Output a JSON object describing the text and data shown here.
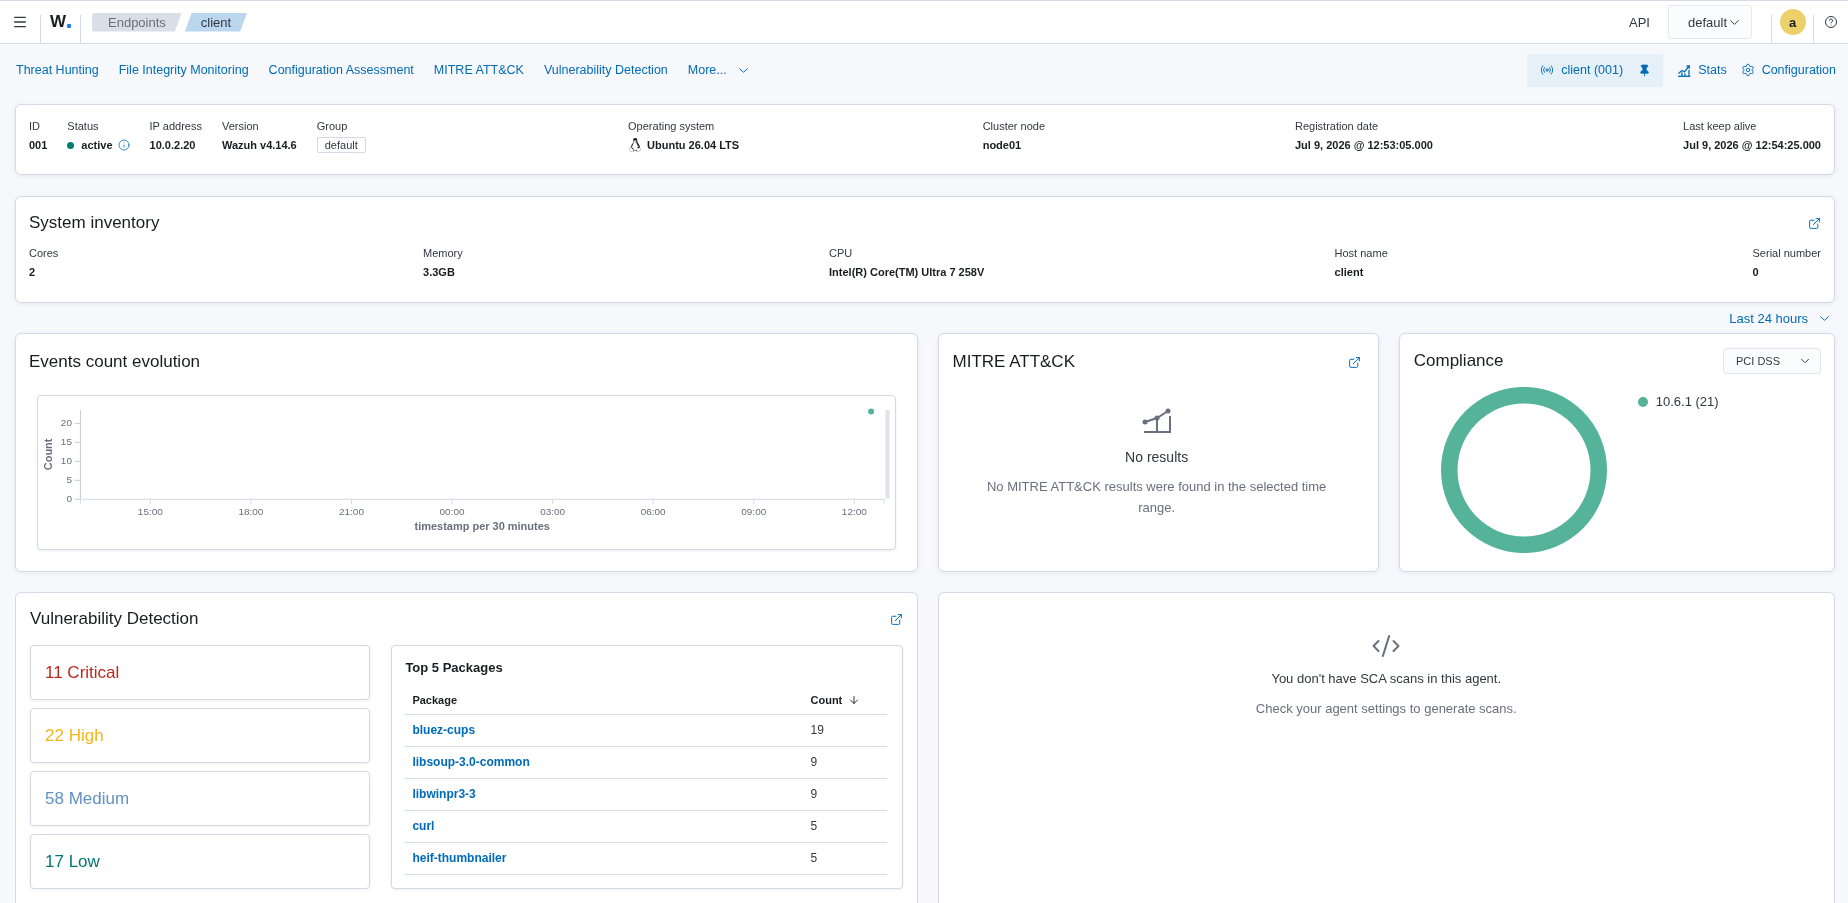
{
  "header": {
    "logo": "W",
    "breadcrumbs": [
      {
        "label": "Endpoints",
        "selected": false
      },
      {
        "label": "client",
        "selected": true
      }
    ],
    "api_label": "API",
    "api_select": "default",
    "avatar": "a"
  },
  "nav": {
    "links": [
      "Threat Hunting",
      "File Integrity Monitoring",
      "Configuration Assessment",
      "MITRE ATT&CK",
      "Vulnerability Detection"
    ],
    "more": "More...",
    "agent": "client (001)",
    "actions": [
      {
        "label": "Stats",
        "kind": "stats"
      },
      {
        "label": "Configuration",
        "kind": "settings"
      }
    ]
  },
  "agent_info": {
    "fields": [
      {
        "label": "ID",
        "value": "001",
        "kind": "text"
      },
      {
        "label": "Status",
        "value": "active",
        "kind": "status",
        "color": "#017d73"
      },
      {
        "label": "IP address",
        "value": "10.0.2.20",
        "kind": "text"
      },
      {
        "label": "Version",
        "value": "Wazuh v4.14.6",
        "kind": "text"
      },
      {
        "label": "Group",
        "value": "default",
        "kind": "badge"
      },
      {
        "label": "Operating system",
        "value": "Ubuntu 26.04 LTS",
        "kind": "os"
      },
      {
        "label": "Cluster node",
        "value": "node01",
        "kind": "text"
      },
      {
        "label": "Registration date",
        "value": "Jul 9, 2026 @ 12:53:05.000",
        "kind": "text"
      },
      {
        "label": "Last keep alive",
        "value": "Jul 9, 2026 @ 12:54:25.000",
        "kind": "text"
      }
    ]
  },
  "system_inventory": {
    "title": "System inventory",
    "fields": [
      {
        "label": "Cores",
        "value": "2"
      },
      {
        "label": "Memory",
        "value": "3.3GB"
      },
      {
        "label": "CPU",
        "value": "Intel(R) Core(TM) Ultra 7 258V"
      },
      {
        "label": "Host name",
        "value": "client"
      },
      {
        "label": "Serial number",
        "value": "0"
      }
    ]
  },
  "time_range": "Last 24 hours",
  "events": {
    "title": "Events count evolution",
    "chart_data": {
      "type": "line",
      "xlabel": "timestamp per 30 minutes",
      "ylabel": "Count",
      "x": [
        "2026-07-09T12:30"
      ],
      "series": [
        {
          "color": "#54b399",
          "values": [
            23
          ],
          "marker": "circle"
        }
      ],
      "xlim": [
        "2026-07-08T12:54",
        "2026-07-09T12:54"
      ],
      "ylim": [
        0,
        23.4
      ],
      "xticks": [
        {
          "value": "2026-07-08T15:00",
          "label": "15:00"
        },
        {
          "value": "2026-07-08T18:00",
          "label": "18:00"
        },
        {
          "value": "2026-07-08T21:00",
          "label": "21:00"
        },
        {
          "value": "2026-07-09T00:00",
          "label": "00:00"
        },
        {
          "value": "2026-07-09T03:00",
          "label": "03:00"
        },
        {
          "value": "2026-07-09T06:00",
          "label": "06:00"
        },
        {
          "value": "2026-07-09T09:00",
          "label": "09:00"
        },
        {
          "value": "2026-07-09T12:00",
          "label": "12:00"
        }
      ],
      "yticks": [
        0,
        5,
        10,
        15,
        20
      ]
    }
  },
  "mitre": {
    "title": "MITRE ATT&CK",
    "empty_title": "No results",
    "empty_text": "No MITRE ATT&CK results were found in the selected time range."
  },
  "compliance": {
    "title": "Compliance",
    "standard": "PCI DSS",
    "legend": [
      {
        "label": "10.6.1 (21)",
        "color": "#54b399"
      }
    ]
  },
  "vulnerability": {
    "title": "Vulnerability Detection",
    "severities": [
      {
        "label": "11 Critical",
        "color": "#bd271e"
      },
      {
        "label": "22 High",
        "color": "#f1b61c"
      },
      {
        "label": "58 Medium",
        "color": "#6092c0"
      },
      {
        "label": "17 Low",
        "color": "#00766d"
      }
    ],
    "packages": {
      "title": "Top 5 Packages",
      "columns": [
        {
          "label": "Package",
          "sorted": false
        },
        {
          "label": "Count",
          "sorted": true
        }
      ],
      "rows": [
        [
          "bluez-cups",
          "19"
        ],
        [
          "libsoup-3.0-common",
          "9"
        ],
        [
          "libwinpr3-3",
          "9"
        ],
        [
          "curl",
          "5"
        ],
        [
          "heif-thumbnailer",
          "5"
        ]
      ]
    }
  },
  "sca": {
    "title": "You don't have SCA scans in this agent.",
    "text": "Check your agent settings to generate scans."
  }
}
